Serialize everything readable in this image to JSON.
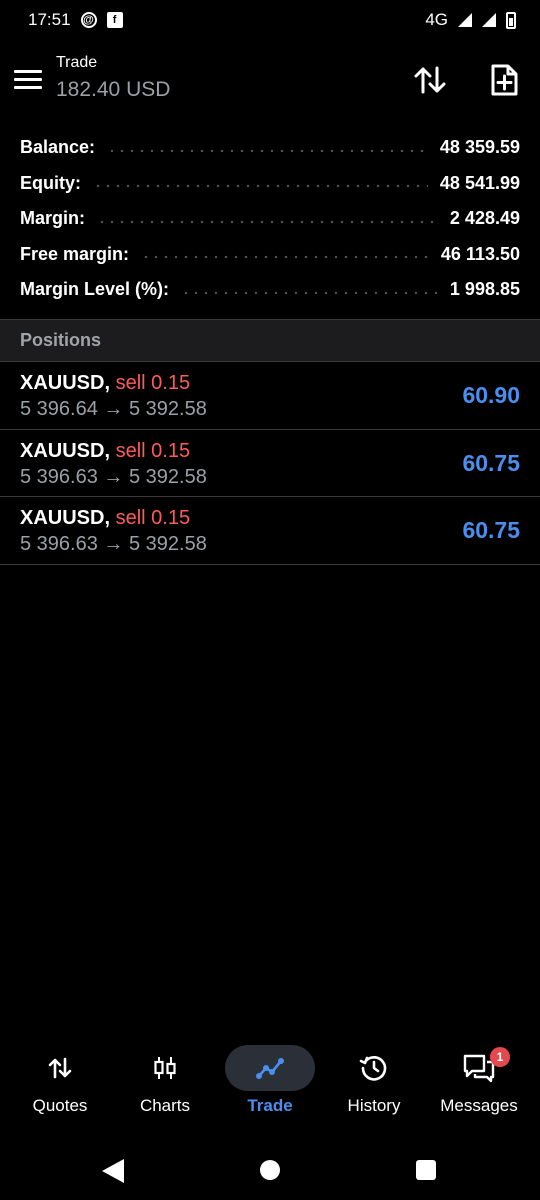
{
  "status_bar": {
    "time": "17:51",
    "network": "4G"
  },
  "header": {
    "title": "Trade",
    "subtitle": "182.40 USD"
  },
  "summary": [
    {
      "label": "Balance:",
      "value": "48 359.59"
    },
    {
      "label": "Equity:",
      "value": "48 541.99"
    },
    {
      "label": "Margin:",
      "value": "2 428.49"
    },
    {
      "label": "Free margin:",
      "value": "46 113.50"
    },
    {
      "label": "Margin Level (%):",
      "value": "1 998.85"
    }
  ],
  "positions": {
    "header": "Positions",
    "items": [
      {
        "symbol": "XAUUSD,",
        "side": "sell 0.15",
        "prices": "5 396.64 → 5 392.58",
        "profit": "60.90"
      },
      {
        "symbol": "XAUUSD,",
        "side": "sell 0.15",
        "prices": "5 396.63 → 5 392.58",
        "profit": "60.75"
      },
      {
        "symbol": "XAUUSD,",
        "side": "sell 0.15",
        "prices": "5 396.63 → 5 392.58",
        "profit": "60.75"
      }
    ]
  },
  "bottom_nav": [
    {
      "label": "Quotes",
      "icon": "quotes-icon"
    },
    {
      "label": "Charts",
      "icon": "charts-icon"
    },
    {
      "label": "Trade",
      "icon": "trade-icon",
      "active": true
    },
    {
      "label": "History",
      "icon": "history-icon"
    },
    {
      "label": "Messages",
      "icon": "messages-icon",
      "badge": "1"
    }
  ],
  "colors": {
    "accent": "#4a8ff0",
    "sell": "#ff5a5a",
    "badge": "#e5484d",
    "muted": "#9aa0a6"
  }
}
